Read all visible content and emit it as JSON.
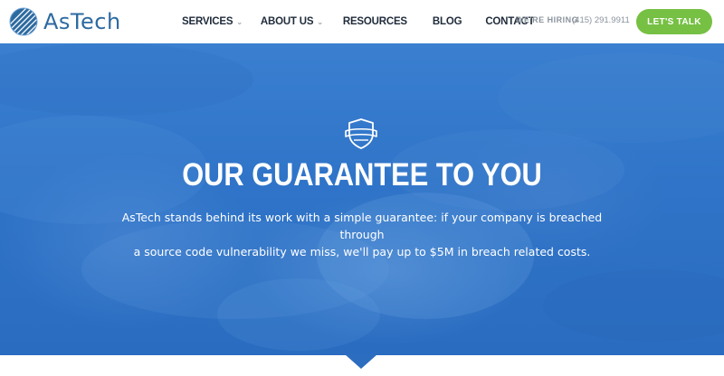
{
  "header": {
    "logo_text": "AsTech",
    "logo_icon": "astech-logo-icon",
    "nav": {
      "services": "SERVICES",
      "about": "ABOUT US",
      "resources": "RESOURCES",
      "blog": "BLOG",
      "contact": "CONTACT"
    },
    "hiring": "WE'RE HIRING",
    "phone": "(415) 291.9911",
    "cta": "LET'S TALK"
  },
  "hero": {
    "icon": "shield-icon",
    "title": "OUR GUARANTEE TO YOU",
    "body_line1": "AsTech stands behind its work with a simple guarantee: if your company is breached through",
    "body_line2": "a source code vulnerability we miss, we'll pay up to $5M in breach related costs."
  },
  "colors": {
    "accent_green": "#76c043",
    "hero_blue": "#2f74c8",
    "logo_blue": "#2d6aa0",
    "nav_text": "#1f2b3a",
    "muted_text": "#8a939c"
  }
}
